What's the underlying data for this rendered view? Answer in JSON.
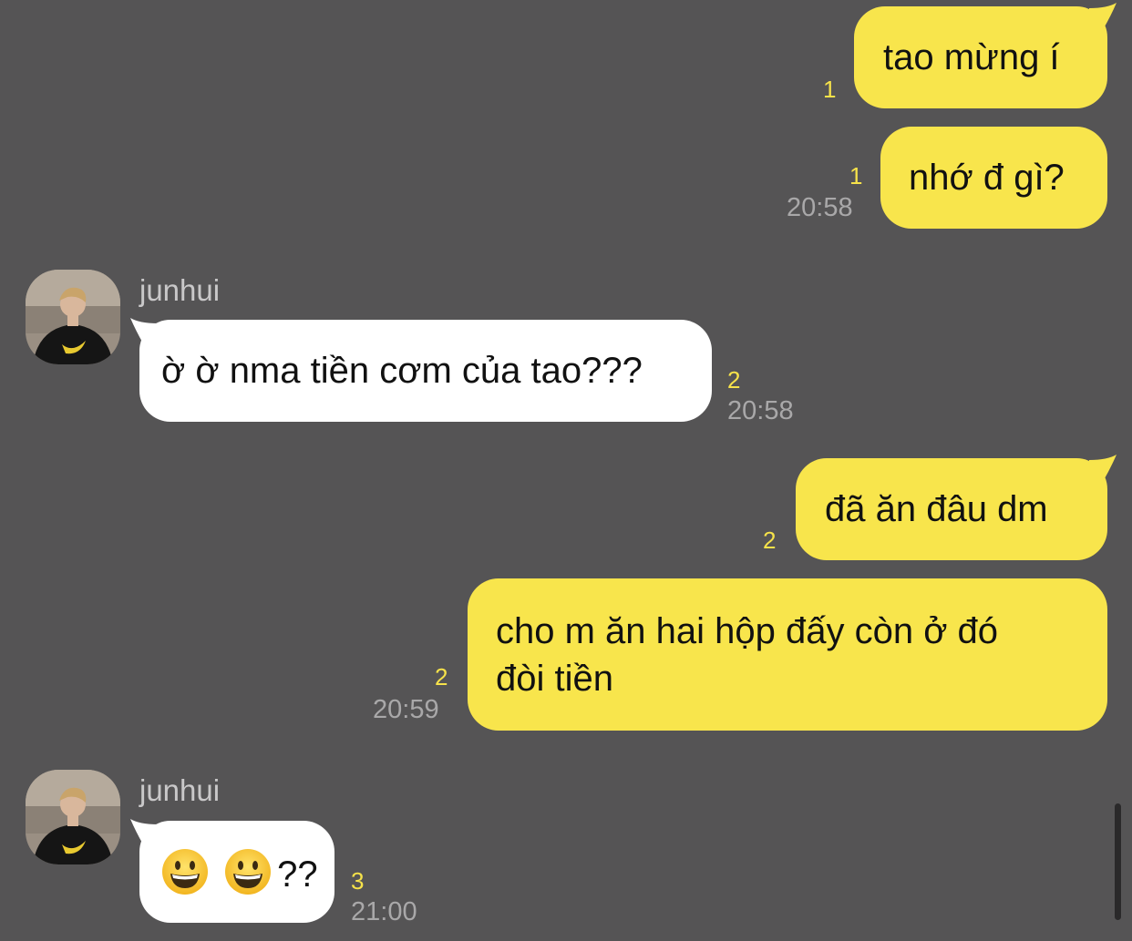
{
  "messages": [
    {
      "direction": "out",
      "text": "tao mừng í",
      "unread": "1",
      "time": ""
    },
    {
      "direction": "out",
      "text": "nhớ đ gì?",
      "unread": "1",
      "time": "20:58"
    },
    {
      "direction": "in",
      "sender": "junhui",
      "text": "ờ ờ nma tiền cơm của tao???",
      "unread": "2",
      "time": "20:58"
    },
    {
      "direction": "out",
      "text": "đã ăn đâu dm",
      "unread": "2",
      "time": ""
    },
    {
      "direction": "out",
      "lines": [
        "cho m ăn hai hộp đấy còn ở đó",
        "đòi tiền"
      ],
      "unread": "2",
      "time": "20:59"
    },
    {
      "direction": "in",
      "sender": "junhui",
      "text": "??",
      "emoji": [
        "grinning-face-emoji",
        "grinning-face-emoji"
      ],
      "unread": "3",
      "time": "21:00"
    }
  ],
  "colors": {
    "background": "#555455",
    "outgoing_bubble": "#f8e54c",
    "incoming_bubble": "#ffffff",
    "unread_count": "#f6e24a",
    "timestamp": "#a9a8a9",
    "sender_name": "#c9c8c9"
  }
}
